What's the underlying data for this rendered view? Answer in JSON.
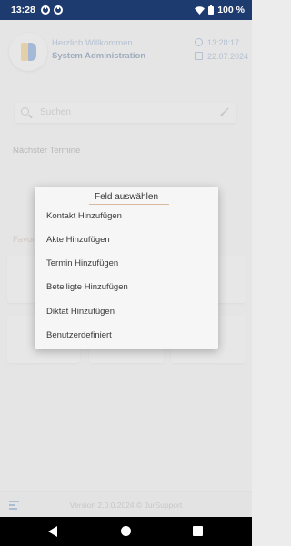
{
  "statusbar": {
    "time": "13:28",
    "battery": "100 %"
  },
  "header": {
    "greeting": "Herzlich Willkommen",
    "system_name": "System Administration",
    "clock": "13:28:17",
    "date": "22.07.2024"
  },
  "search": {
    "placeholder": "Suchen"
  },
  "sections": {
    "next_appointments": "Nächster Termine",
    "favorites": "Favor"
  },
  "footer": {
    "version": "Version 2.0.0.2024 © JurSupport"
  },
  "dialog": {
    "title": "Feld auswählen",
    "items": [
      "Kontakt Hinzufügen",
      "Akte Hinzufügen",
      "Termin Hinzufügen",
      "Beteiligte Hinzufügen",
      "Diktat Hinzufügen",
      "Benutzerdefiniert"
    ]
  },
  "colors": {
    "statusbar": "#1e3b6f",
    "accent": "#e2a56a",
    "brand_blue": "#2f73c7",
    "brand_yellow": "#f2b33d"
  }
}
